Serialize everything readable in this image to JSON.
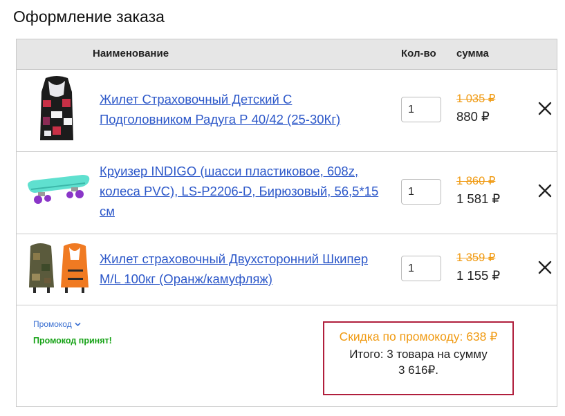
{
  "page": {
    "title": "Оформление заказа"
  },
  "table": {
    "headers": {
      "name": "Наименование",
      "qty": "Кол-во",
      "sum": "сумма"
    },
    "items": [
      {
        "name_line1": "Жилет Страховочный Детский С",
        "name_line2": "Подголовником Радуга Р 40/42 (25-30Кг)",
        "name_line3": "",
        "qty": "1",
        "old_price": "1 035 ₽",
        "price": "880 ₽"
      },
      {
        "name_line1": "Круизер INDIGO (шасси пластиковое, 608z,",
        "name_line2": "колеса PVC), LS-P2206-D, Бирюзовый, 56,5*15",
        "name_line3": "см",
        "qty": "1",
        "old_price": "1 860 ₽",
        "price": "1 581 ₽"
      },
      {
        "name_line1": "Жилет страховочный Двухсторонний Шкипер",
        "name_line2": "M/L 100кг (Оранж/камуфляж)",
        "name_line3": "",
        "qty": "1",
        "old_price": "1 359 ₽",
        "price": "1 155 ₽"
      }
    ]
  },
  "promo": {
    "toggle_label": "Промокод",
    "status": "Промокод принят!"
  },
  "summary": {
    "discount": "Скидка по промокоду: 638 ₽",
    "total_line1": "Итого: 3 товара на сумму",
    "total_line2": "3 616₽."
  },
  "icons": {
    "remove": "close-icon",
    "toggle": "chevron-down-icon"
  },
  "colors": {
    "link": "#2d58c9",
    "old_price": "#f09a12",
    "accepted": "#16a216",
    "summary_border": "#b01e3c",
    "header_bg": "#e6e6e6"
  }
}
